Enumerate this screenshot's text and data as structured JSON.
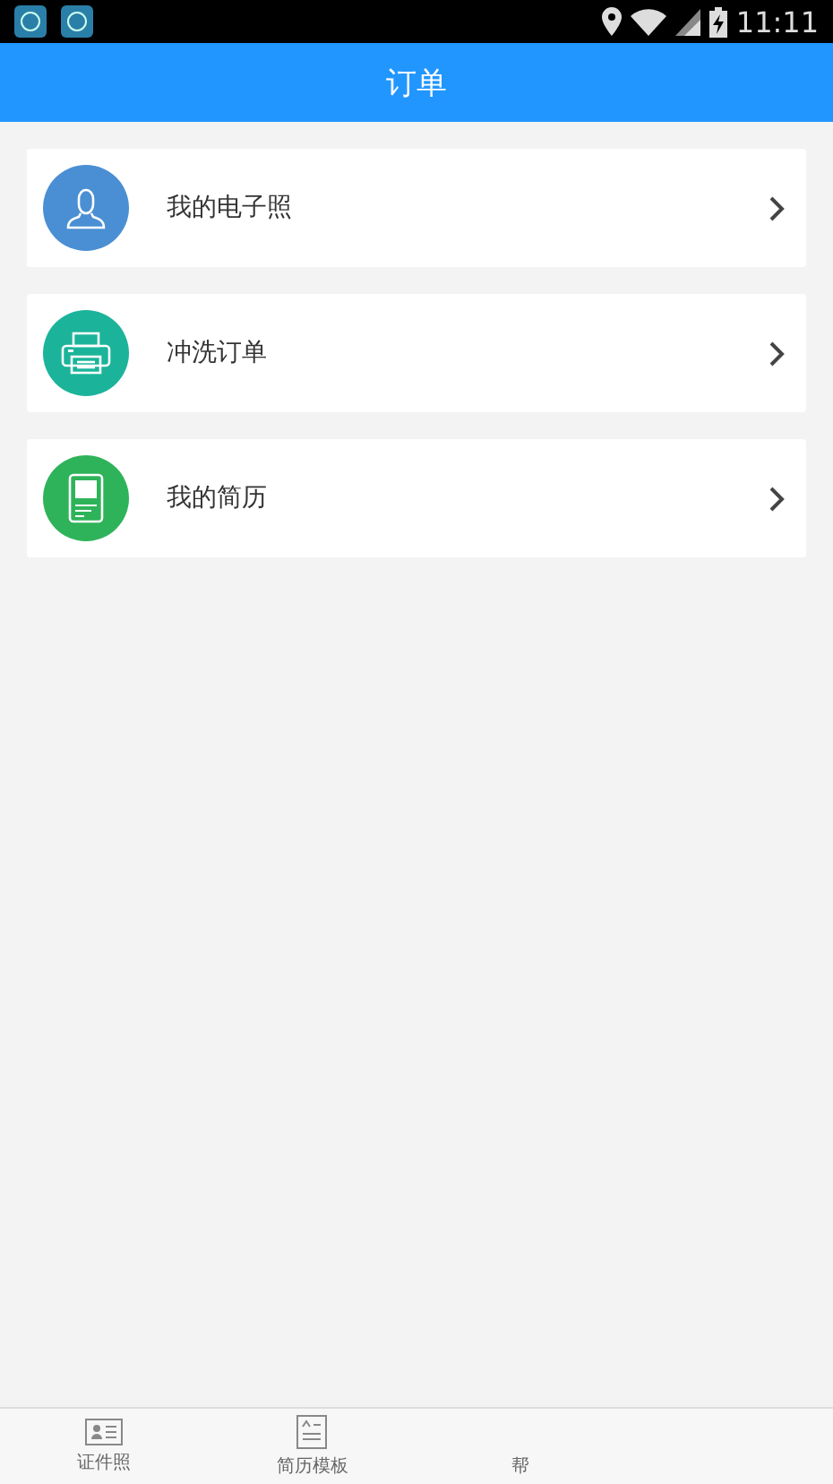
{
  "status_bar": {
    "time": "11:11"
  },
  "header": {
    "title": "订单"
  },
  "menu_items": [
    {
      "label": "我的电子照",
      "kind": "person",
      "color": "#4a8fd3"
    },
    {
      "label": "冲洗订单",
      "kind": "printer",
      "color": "#1bb49a"
    },
    {
      "label": "我的简历",
      "kind": "document",
      "color": "#2fb35a"
    }
  ],
  "tabs": [
    {
      "label": "证件照",
      "kind": "id-card"
    },
    {
      "label": "简历模板",
      "kind": "template"
    },
    {
      "label": "帮",
      "kind": "none"
    }
  ]
}
